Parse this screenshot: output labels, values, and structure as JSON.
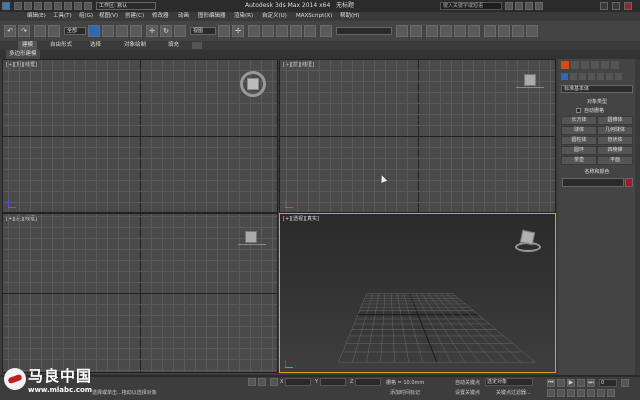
{
  "titlebar": {
    "workspace_label": "工作区: 默认",
    "app_title": "Autodesk 3ds Max  2014 x64",
    "doc_title": "无标题",
    "search_placeholder": "键入关键字或短语"
  },
  "menus": [
    "编辑(E)",
    "工具(T)",
    "组(G)",
    "视图(V)",
    "创建(C)",
    "修改器",
    "动画",
    "图形编辑器",
    "渲染(R)",
    "自定义(U)",
    "MAXScript(X)",
    "帮助(H)"
  ],
  "toolbar": {
    "filter_value": "全部",
    "refcoord_value": "视图"
  },
  "ribbon_tabs": [
    "建模",
    "自由形式",
    "选择",
    "对象绘制",
    "填充"
  ],
  "subribbon_label": "多边形建模",
  "viewports": [
    {
      "label": "[+][顶][线框]"
    },
    {
      "label": "[+][前][线框]"
    },
    {
      "label": "[+][左][线框]"
    },
    {
      "label": "[+][透视][真实]"
    }
  ],
  "cmdpanel": {
    "category_value": "标准基本体",
    "object_type_title": "对象类型",
    "autogrid_label": "自动栅格",
    "buttons": [
      [
        "长方体",
        "圆锥体"
      ],
      [
        "球体",
        "几何球体"
      ],
      [
        "圆柱体",
        "管状体"
      ],
      [
        "圆环",
        "四棱锥"
      ],
      [
        "茶壶",
        "平面"
      ]
    ],
    "name_color_title": "名称和颜色"
  },
  "status": {
    "grid_label": "栅格 = 10.0mm",
    "autokey_label": "自动关键点",
    "selected_value": "选定对象",
    "setkey_label": "设置关键点",
    "keyfilter_label": "关键点过滤器...",
    "addtime_label": "添加时间标记",
    "prompt_text": "选择或单击...拖动以选择对象",
    "frame_value": "0"
  },
  "watermark": {
    "cn_text": "马良中国",
    "url_text": "www.mlabc.com"
  },
  "colors": {
    "accent": "#e0a020",
    "swatch": "#a01830"
  }
}
